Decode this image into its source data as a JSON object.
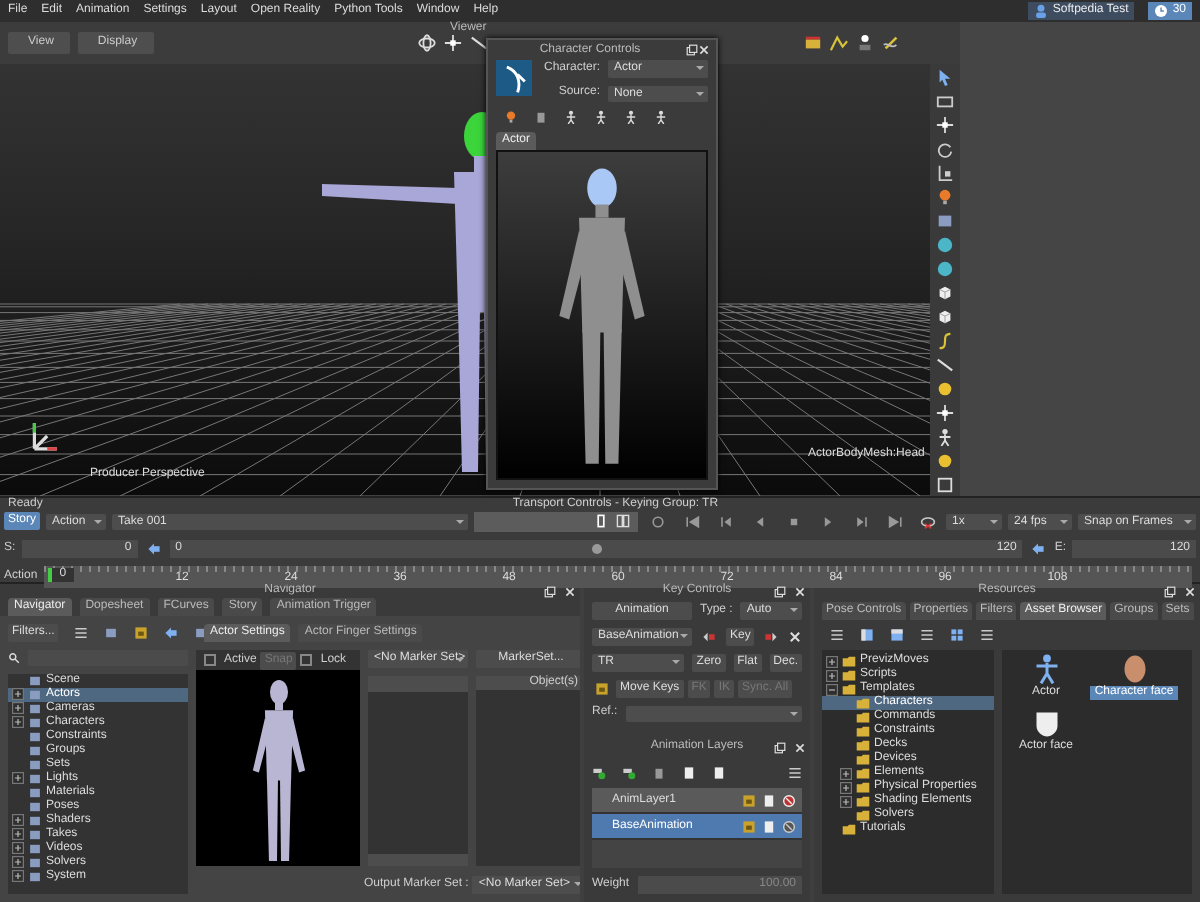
{
  "menu_bar": {
    "items": [
      "File",
      "Edit",
      "Animation",
      "Settings",
      "Layout",
      "Open Reality",
      "Python Tools",
      "Window",
      "Help"
    ],
    "user": "Softpedia Test",
    "clock": "30"
  },
  "viewer": {
    "title": "Viewer",
    "buttons": [
      "View",
      "Display"
    ],
    "camera_label": "Producer Perspective",
    "selection_label": "ActorBodyMesh:Head"
  },
  "character_controls": {
    "title": "Character Controls",
    "character_label": "Character:",
    "character": "Actor",
    "source_label": "Source:",
    "source": "None",
    "tabs": [
      {
        "label": "Actor",
        "selected": true
      }
    ]
  },
  "transport": {
    "status": "Ready",
    "title": "Transport Controls  -  Keying Group: TR",
    "story": {
      "label": "Story",
      "on": true
    },
    "mode": "Action",
    "take": "Take 001",
    "speed": "1x",
    "fps": "24 fps",
    "snap": "Snap on Frames",
    "start_label": "S:",
    "start": "0",
    "slider": {
      "start": "0",
      "end": "120",
      "level": 0.5
    },
    "end_label": "E:",
    "end": "120",
    "timeline": {
      "label": "Action",
      "current": "0",
      "ticks": [
        "12",
        "24",
        "36",
        "48",
        "60",
        "72",
        "84",
        "96",
        "108"
      ]
    }
  },
  "navigator": {
    "title": "Navigator",
    "tabs": [
      {
        "label": "Navigator",
        "selected": true
      },
      {
        "label": "Dopesheet",
        "selected": false
      },
      {
        "label": "FCurves",
        "selected": false
      },
      {
        "label": "Story",
        "selected": false
      },
      {
        "label": "Animation Trigger",
        "selected": false
      }
    ],
    "filters": "Filters...",
    "tree": [
      {
        "label": "Scene",
        "selected": false
      },
      {
        "label": "Actors",
        "selected": true,
        "expanded": false
      },
      {
        "label": "Cameras",
        "selected": false,
        "expanded": false
      },
      {
        "label": "Characters",
        "selected": false,
        "expanded": false
      },
      {
        "label": "Constraints",
        "selected": false
      },
      {
        "label": "Groups",
        "selected": false
      },
      {
        "label": "Sets",
        "selected": false
      },
      {
        "label": "Lights",
        "selected": false,
        "expanded": false
      },
      {
        "label": "Materials",
        "selected": false
      },
      {
        "label": "Poses",
        "selected": false
      },
      {
        "label": "Shaders",
        "selected": false,
        "expanded": false
      },
      {
        "label": "Takes",
        "selected": false,
        "expanded": false
      },
      {
        "label": "Videos",
        "selected": false,
        "expanded": false
      },
      {
        "label": "Solvers",
        "selected": false,
        "expanded": false
      },
      {
        "label": "System",
        "selected": false,
        "expanded": false
      }
    ],
    "settings_tabs": [
      {
        "label": "Actor Settings",
        "selected": true
      },
      {
        "label": "Actor Finger Settings",
        "selected": false
      }
    ],
    "active": {
      "label": "Active",
      "checked": false
    },
    "snap": {
      "label": "Snap",
      "disabled": true
    },
    "lock": {
      "label": "Lock",
      "checked": false
    },
    "marker_set": "<No Marker Set>",
    "marker_set_button": "MarkerSet...",
    "objects_header": "Object(s)",
    "output_label": "Output Marker Set :",
    "output_marker_set": "<No Marker Set>"
  },
  "key_controls": {
    "title": "Key Controls",
    "animation": "Animation",
    "type_label": "Type :",
    "type": "Auto",
    "layer": "BaseAnimation",
    "key": "Key",
    "keying_group": "TR",
    "zero": "Zero",
    "flat": "Flat",
    "dec": "Dec.",
    "move_keys": "Move Keys",
    "fk": "FK",
    "ik": "IK",
    "sync": "Sync. All",
    "ref_label": "Ref.:"
  },
  "animation_layers": {
    "title": "Animation Layers",
    "layers": [
      {
        "name": "AnimLayer1",
        "selected": false
      },
      {
        "name": "BaseAnimation",
        "selected": true
      }
    ],
    "weight_label": "Weight",
    "weight": "100.00"
  },
  "resources": {
    "title": "Resources",
    "tabs": [
      {
        "label": "Pose Controls",
        "selected": false
      },
      {
        "label": "Properties",
        "selected": false
      },
      {
        "label": "Filters",
        "selected": false
      },
      {
        "label": "Asset Browser",
        "selected": true
      },
      {
        "label": "Groups",
        "selected": false
      },
      {
        "label": "Sets",
        "selected": false
      }
    ],
    "tree": [
      {
        "label": "PrevizMoves",
        "selected": false,
        "expanded": false
      },
      {
        "label": "Scripts",
        "selected": false,
        "expanded": false
      },
      {
        "label": "Templates",
        "selected": false,
        "expanded": true,
        "children": [
          {
            "label": "Characters",
            "selected": true
          },
          {
            "label": "Commands",
            "selected": false
          },
          {
            "label": "Constraints",
            "selected": false
          },
          {
            "label": "Decks",
            "selected": false
          },
          {
            "label": "Devices",
            "selected": false
          },
          {
            "label": "Elements",
            "selected": false,
            "expanded": false
          },
          {
            "label": "Physical Properties",
            "selected": false,
            "expanded": false
          },
          {
            "label": "Shading Elements",
            "selected": false,
            "expanded": false
          },
          {
            "label": "Solvers",
            "selected": false
          }
        ]
      },
      {
        "label": "Tutorials",
        "selected": false
      }
    ],
    "assets": [
      {
        "label": "Actor",
        "kind": "actor",
        "selected": false
      },
      {
        "label": "Character face",
        "kind": "face",
        "selected": true
      },
      {
        "label": "Actor face",
        "kind": "mask",
        "selected": false
      }
    ]
  }
}
